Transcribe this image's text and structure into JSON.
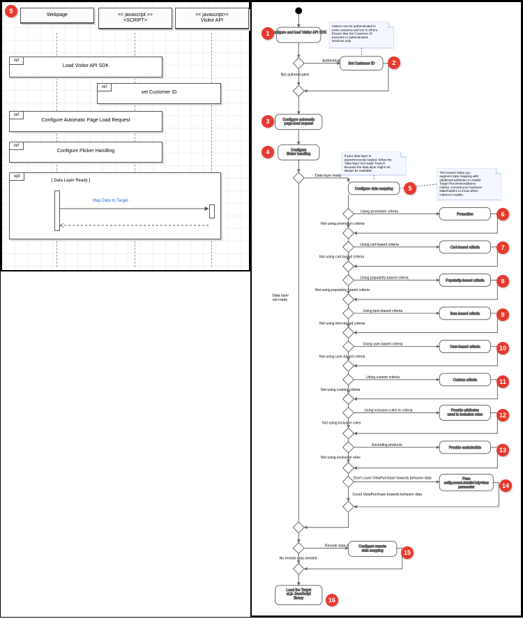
{
  "seq": {
    "lanes": {
      "webpage": "Webpage",
      "script_top": "<< javascript >>",
      "script_bot": "<SCRIPT>",
      "visapi_top": "<< javascript>>",
      "visapi_bot": "Visitor API"
    },
    "frag_ref": "ref",
    "frag_opt": "opt",
    "load_sdk": "Load Visitor API SDK",
    "set_cust": "set Customer ID",
    "cfg_auto": "Configure Automatic Page Load Request",
    "cfg_flicker": "Configure Flicker Handling",
    "opt_guard": "[ Data Layer Ready ]",
    "map_data": "Map Data to Target"
  },
  "flow": {
    "n1": "Configure and load\nVisitor API SDK",
    "n2": "Set Customer ID",
    "n3": "Configure automatic\npage-load request",
    "n4": "Configure\nflicker handling",
    "n5": "Configure data mapping",
    "n6": "Promotion",
    "n7": "Cart-based criteria",
    "n8": "Popularity-based criteria",
    "n9": "Item-based criteria",
    "n10": "User-based criteria",
    "n11": "Custom criteria",
    "n12": "Provide attributes\nused in inclusion rules",
    "n13": "Provide excludedIds",
    "n14": "Pass\nentity.event.detailsOnly=true\nparameter",
    "n15": "Configure remote\ndata mapping",
    "n16": "Load the Target\nat.js JavaScript\nlibrary",
    "lbl_auth": "Authenticated",
    "lbl_noauth": "Not authenticated",
    "lbl_dlr": "Data layer ready",
    "lbl_dlnr": "Data layer\nnot ready",
    "lbl_upc": "Using promotion criteria",
    "lbl_nupc": "Not using promotion criteria",
    "lbl_ucbc": "Using cart-based criteria",
    "lbl_nucbc": "Not using cart-based criteria",
    "lbl_upbc": "Using popularity-based criteria",
    "lbl_nupbc": "Not using popularity-based criteria",
    "lbl_uibc": "Using item-based criteria",
    "lbl_nuibc": "Not using item-based criteria",
    "lbl_uubc": "Using user-based criteria",
    "lbl_nuubc": "Not using user-based criteria",
    "lbl_ucc": "Using custom criteria",
    "lbl_nucc": "Not using custom criteria",
    "lbl_uir": "Using inclusion rules in criteria",
    "lbl_nuir": "Not using inclusion rules",
    "lbl_exc": "Excluding products",
    "lbl_nuex": "Not using exclusion rules",
    "lbl_dcvp": "Don't count ViewPurchase towards behavior data",
    "lbl_cvp": "Count ViewPurchase towards behavior data",
    "lbl_rdn": "Remote data needed",
    "lbl_nrdn": "No remote data needed",
    "note1": "Visitors can be authenticated in\nsome sessions and not in others.\nEnsure that Set Customer ID\nexecutes in authenticated\nsessions only.",
    "note2": "If your data layer is\nasynchronously loaded, follow the\n\"data layer not ready\" branch\nbecause the data layer might not\nalways be available.",
    "note3": "This branch helps you\naugment data mapping with\nadditional attributes to enable\nTarget Recommendations\ncriteria. Consult your business\nstakeholders to know which\ncriteria to enable."
  },
  "badges": [
    "1",
    "2",
    "3",
    "4",
    "5",
    "6",
    "7",
    "8",
    "9",
    "10",
    "11",
    "12",
    "13",
    "14",
    "15",
    "16"
  ]
}
